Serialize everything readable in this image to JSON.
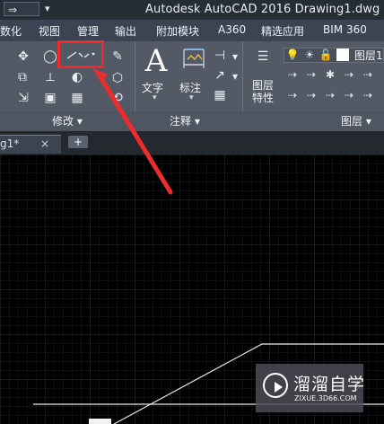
{
  "window": {
    "title": "Autodesk AutoCAD 2016    Drawing1.dwg",
    "qat_arrow": "⇒",
    "qat_dropdown": "▾"
  },
  "menu": {
    "tabs": [
      "数化",
      "视图",
      "管理",
      "输出",
      "附加模块",
      "A360",
      "精选应用",
      "BIM 360"
    ]
  },
  "ribbon": {
    "modify_label": "修改",
    "annotation_label": "注释",
    "layer_label": "图层",
    "text_label": "文字",
    "dimension_label": "标注",
    "layer_properties_label": "图层\n特性",
    "layer_name": "图层1",
    "highlighted_tool": "break-tool"
  },
  "document": {
    "tab_label": "g1*",
    "close_label": "×",
    "add_label": "+"
  },
  "watermark": {
    "name": "溜溜自学",
    "site": "ZIXUE.3D66.COM"
  },
  "colors": {
    "accent": "#ef2b2b",
    "title_bg": "#262d35",
    "menu_bg": "#3b4452",
    "ribbon_bg": "#535a66",
    "canvas_bg": "#000000",
    "grid": "#2d2f33"
  }
}
